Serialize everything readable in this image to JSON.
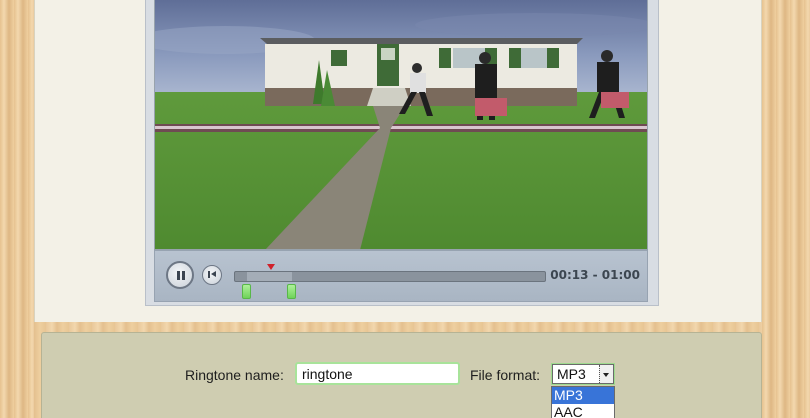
{
  "player": {
    "time_readout": "00:13 - 01:00",
    "icons": {
      "play_pause": "pause-icon",
      "rewind": "skip-to-start-icon"
    }
  },
  "form": {
    "ringtone_name_label": "Ringtone name:",
    "ringtone_name_value": "ringtone",
    "file_format_label": "File format:",
    "file_format_selected": "MP3",
    "file_format_options": [
      "MP3",
      "AAC"
    ]
  },
  "colors": {
    "panel_bg": "#cfcdb1",
    "handle_green": "#6fd35a",
    "playhead_red": "#d0212a",
    "selected_option": "#3874d8"
  }
}
